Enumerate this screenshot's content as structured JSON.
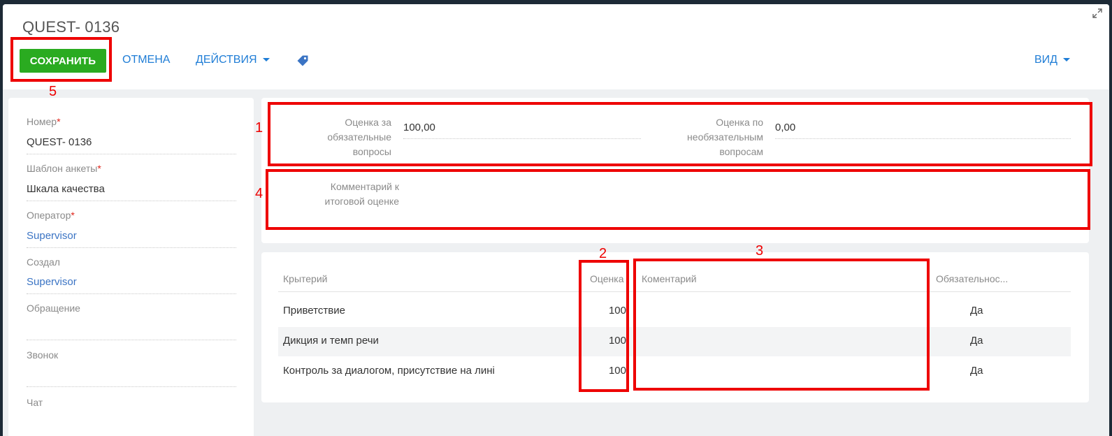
{
  "page": {
    "title": "QUEST- 0136"
  },
  "toolbar": {
    "save_label": "СОХРАНИТЬ",
    "cancel_label": "ОТМЕНА",
    "actions_label": "ДЕЙСТВИЯ",
    "view_label": "ВИД"
  },
  "left_fields": [
    {
      "label": "Номер",
      "required": "*",
      "value": "QUEST- 0136"
    },
    {
      "label": "Шаблон анкеты",
      "required": "*",
      "value": "Шкала качества"
    },
    {
      "label": "Оператор",
      "required": "*",
      "value": "Supervisor"
    },
    {
      "label": "Создал",
      "value": "Supervisor"
    },
    {
      "label": "Обращение",
      "value": ""
    },
    {
      "label": "Звонок",
      "value": ""
    },
    {
      "label": "Чат",
      "value": ""
    }
  ],
  "summary": {
    "required_score_label": "Оценка за\nобязательные\nвопросы",
    "required_score_value": "100,00",
    "optional_score_label": "Оценка по\nнеобязательным\nвопросам",
    "optional_score_value": "0,00",
    "comment_label": "Комментарий к\nитоговой оценке",
    "comment_value": ""
  },
  "grid": {
    "columns": [
      "Крытерий",
      "Оценка",
      "Коментарий",
      "Обязательнос..."
    ],
    "rows": [
      {
        "criterion": "Приветствие",
        "score": "100",
        "comment": "",
        "mandatory": "Да"
      },
      {
        "criterion": "Дикция и темп речи",
        "score": "100",
        "comment": "",
        "mandatory": "Да"
      },
      {
        "criterion": "Контроль за диалогом, присутствие на лині",
        "score": "100",
        "comment": "",
        "mandatory": "Да"
      }
    ]
  },
  "annotations": [
    "1",
    "2",
    "3",
    "4",
    "5"
  ],
  "colors": {
    "accent": "#1f7dd6",
    "save": "#2aab20",
    "annotation": "#ee0000"
  }
}
